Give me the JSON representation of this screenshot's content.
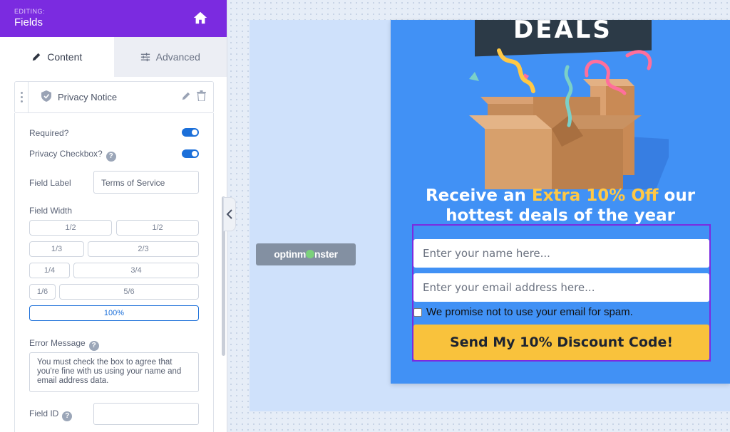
{
  "header": {
    "editing_label": "EDITING:",
    "title": "Fields",
    "icon": "home-icon"
  },
  "tabs": [
    {
      "label": "Content",
      "icon": "pencil-icon",
      "active": true
    },
    {
      "label": "Advanced",
      "icon": "sliders-icon",
      "active": false
    }
  ],
  "field": {
    "name": "Privacy Notice",
    "icon": "shield-icon"
  },
  "options": {
    "required_label": "Required?",
    "required": true,
    "privacy_checkbox_label": "Privacy Checkbox?",
    "privacy_checkbox": true,
    "field_label_label": "Field Label",
    "field_label_value": "Terms of Service",
    "field_width_label": "Field Width",
    "widths": [
      "1/2",
      "1/2",
      "1/3",
      "2/3",
      "1/4",
      "3/4",
      "1/6",
      "5/6",
      "100%"
    ],
    "selected_width": "100%",
    "error_message_label": "Error Message",
    "error_message_value": "You must check the box to agree that you're fine with us using your name and email address data.",
    "field_id_label": "Field ID",
    "field_id_value": ""
  },
  "canvas": {
    "badge_left": "optinm",
    "badge_right": "nster",
    "banner": "DEALS",
    "headline_pre": "Receive an ",
    "headline_accent": "Extra 10% Off",
    "headline_post": " our",
    "headline_line2": "hottest deals of the year",
    "name_placeholder": "Enter your name here...",
    "email_placeholder": "Enter your email address here...",
    "privacy_text": "We promise not to use your email for spam.",
    "cta_label": "Send My 10% Discount Code!"
  },
  "colors": {
    "brand_purple": "#7b2be0",
    "toggle_blue": "#1b6fd9",
    "popup_blue": "#4191f5",
    "cta_yellow": "#f9c23c",
    "accent_yellow": "#ffc845"
  }
}
